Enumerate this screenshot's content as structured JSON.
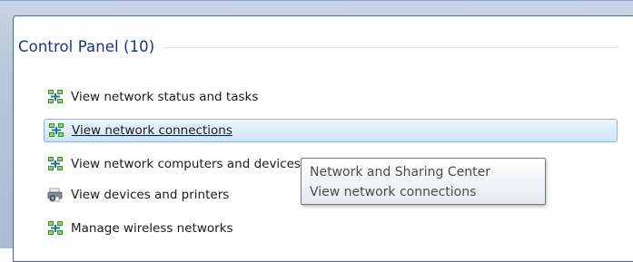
{
  "search_results": {
    "group_title": "Control Panel (10)",
    "items": [
      {
        "label": "View network status and tasks",
        "icon": "network-icon"
      },
      {
        "label": "View network connections",
        "icon": "network-icon",
        "hovered": true
      },
      {
        "label": "View network computers and devices",
        "icon": "network-icon"
      },
      {
        "label": "View devices and printers",
        "icon": "devices-printers-icon"
      },
      {
        "label": "Manage wireless networks",
        "icon": "network-icon"
      }
    ]
  },
  "tooltip": {
    "line1": "Network and Sharing Center",
    "line2": "View network connections"
  },
  "colors": {
    "group_title": "#1e3287",
    "hover_border": "#86b4e6",
    "hover_fill": "#dcebfb"
  }
}
